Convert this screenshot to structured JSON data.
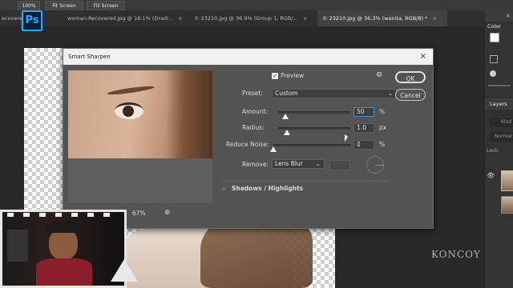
{
  "optionbar": {
    "zoom_label": "100%",
    "fit_screen_label": "Fit Screen",
    "fill_screen_label": "Fill Screen"
  },
  "app": {
    "logo_text": "Ps"
  },
  "tabs": [
    {
      "label": "ecovered..."
    },
    {
      "label": "woman-Recovered.jpg @ 18.1% (Gradi..."
    },
    {
      "label": "© 23210.jpg @ 36.9% (Group 1, RGB/..."
    },
    {
      "label": "© 23210.jpg @ 36.3% (wanita, RGB/8) *"
    }
  ],
  "close_glyph": "×",
  "right_panel": {
    "color_tab": "Color",
    "layers_tab": "Layers",
    "search_label": "Kind",
    "blend_mode": "Normal",
    "lock_label": "Lock:"
  },
  "dialog": {
    "title": "Smart Sharpen",
    "preview_label": "Preview",
    "preset_label": "Preset:",
    "preset_value": "Custom",
    "amount_label": "Amount:",
    "amount_value": "50",
    "amount_unit": "%",
    "amount_fraction": 0.1,
    "radius_label": "Radius:",
    "radius_value": "1.0",
    "radius_unit": "px",
    "radius_fraction": 0.12,
    "reduce_noise_label": "Reduce Noise:",
    "reduce_noise_value": "0",
    "reduce_noise_unit": "%",
    "reduce_noise_fraction": 0.0,
    "remove_label": "Remove:",
    "remove_value": "Lens Blur",
    "section_label": "Shadows / Highlights",
    "ok_label": "OK",
    "cancel_label": "Cancel",
    "zoom_value": "67%"
  },
  "watermark": "KONCOY"
}
